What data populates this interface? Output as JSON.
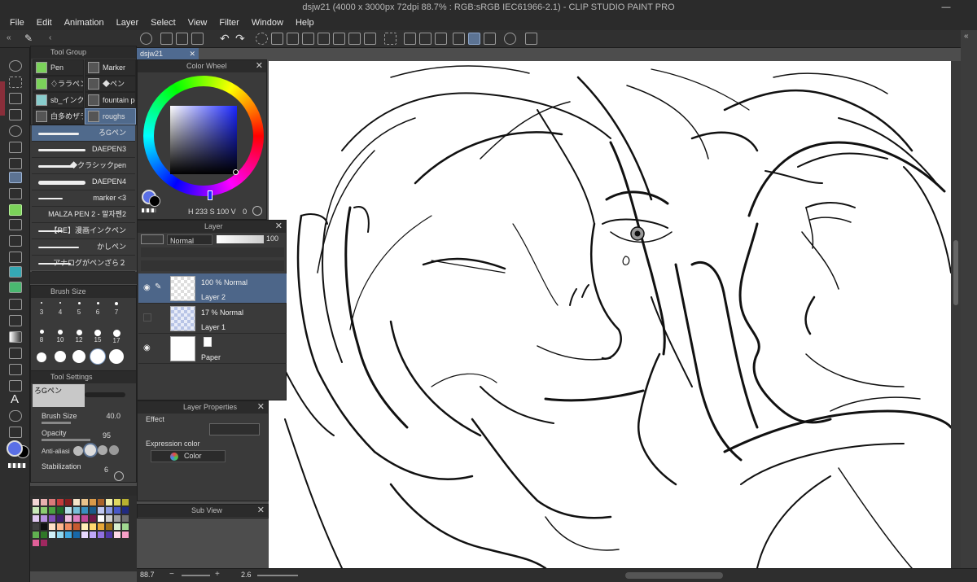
{
  "window": {
    "title": "dsjw21 (4000 x 3000px 72dpi 88.7% : RGB:sRGB IEC61966-2.1) - CLIP STUDIO PAINT PRO",
    "minimize": "—",
    "close": "✕"
  },
  "menu": [
    "File",
    "Edit",
    "Animation",
    "Layer",
    "Select",
    "View",
    "Filter",
    "Window",
    "Help"
  ],
  "tool_group": {
    "title": "Tool Group",
    "buttons": [
      {
        "label": "Pen",
        "selected": false
      },
      {
        "label": "Marker",
        "selected": false
      },
      {
        "label": "♢ララペン",
        "selected": false
      },
      {
        "label": "◆ペン",
        "selected": false
      },
      {
        "label": "sb_インク用",
        "selected": false
      },
      {
        "label": "fountain pe",
        "selected": false
      },
      {
        "label": "白多めザラ",
        "selected": false
      },
      {
        "label": "roughs",
        "selected": true
      }
    ]
  },
  "brushes": [
    {
      "name": "ろGペン",
      "selected": true
    },
    {
      "name": "DAEPEN3",
      "selected": false
    },
    {
      "name": "◆クラシックpen",
      "selected": false
    },
    {
      "name": "DAEPEN4",
      "selected": false
    },
    {
      "name": "marker <3",
      "selected": false
    },
    {
      "name": "MALZA PEN 2 - 말자펜2",
      "selected": false
    },
    {
      "name": "【RE】漫画インクペン",
      "selected": false
    },
    {
      "name": "かしペン",
      "selected": false
    },
    {
      "name": "アナログがペンざら２",
      "selected": false
    }
  ],
  "brush_size": {
    "title": "Brush Size",
    "sizes": [
      "3",
      "4",
      "5",
      "6",
      "7",
      "8",
      "10",
      "12",
      "15",
      "17",
      "",
      "",
      "",
      "",
      ""
    ]
  },
  "tool_settings": {
    "title": "Tool Settings",
    "preset_name": "ろGペン",
    "brush_size_label": "Brush Size",
    "brush_size_value": "40.0",
    "opacity_label": "Opacity",
    "opacity_value": "95",
    "antialias_label": "Anti-aliasi",
    "stabilization_label": "Stabilization",
    "stabilization_value": "6"
  },
  "document_tab": {
    "name": "dsjw21",
    "close": "✕"
  },
  "color_wheel": {
    "title": "Color Wheel",
    "h_label": "H",
    "h_value": "233",
    "s_label": "S",
    "s_value": "100",
    "v_label": "V",
    "v_value": "0",
    "colors": {
      "main": "#5a6fe6",
      "sub": "#000000",
      "square_hue": "#1a26ff"
    }
  },
  "layer_panel": {
    "title": "Layer",
    "blend_mode": "Normal",
    "opacity_value": "100",
    "layers": [
      {
        "mode": "100 % Normal",
        "name": "Layer 2",
        "selected": true
      },
      {
        "mode": "17 % Normal",
        "name": "Layer 1",
        "selected": false
      },
      {
        "mode": "",
        "name": "Paper",
        "selected": false
      }
    ]
  },
  "layer_properties": {
    "title": "Layer Properties",
    "effect_label": "Effect",
    "expression_color_label": "Expression color",
    "expression_color_value": "Color"
  },
  "sub_view": {
    "title": "Sub View"
  },
  "status": {
    "zoom": "88.7",
    "angle": "2.6"
  },
  "palette_colors": [
    "#f2d6d6",
    "#e8b0b0",
    "#d97a7a",
    "#c43c3c",
    "#8a1f1f",
    "#f5e4c8",
    "#e9c38c",
    "#d99a4a",
    "#a8622a",
    "#f4f0b0",
    "#e0d860",
    "#b8b030",
    "#c8e8b8",
    "#8ccc70",
    "#4aa040",
    "#1e6a28",
    "#b8e0e8",
    "#78c0d8",
    "#3890c0",
    "#1a5a8a",
    "#c0c8f0",
    "#8898e0",
    "#4858c8",
    "#202a80",
    "#e0c8f0",
    "#b890e0",
    "#8050b8",
    "#402070",
    "#f0c0e0",
    "#e080c0",
    "#c04898",
    "#701848",
    "#ffffff",
    "#d0d0d0",
    "#a0a0a0",
    "#707070",
    "#404040",
    "#101010",
    "#ffe0c8",
    "#ffb890",
    "#f08a60",
    "#c85a30",
    "#fff0b8",
    "#ffd870",
    "#e8a838",
    "#a07018",
    "#d8f0d0",
    "#a0d890",
    "#60b050",
    "#307828",
    "#d0f0f8",
    "#90d8f0",
    "#40a8e0",
    "#1868a8",
    "#e8d8ff",
    "#c0a8f8",
    "#9070e0",
    "#5038a8",
    "#ffd8e8",
    "#f8a0c8",
    "#e06098",
    "#a02860"
  ]
}
